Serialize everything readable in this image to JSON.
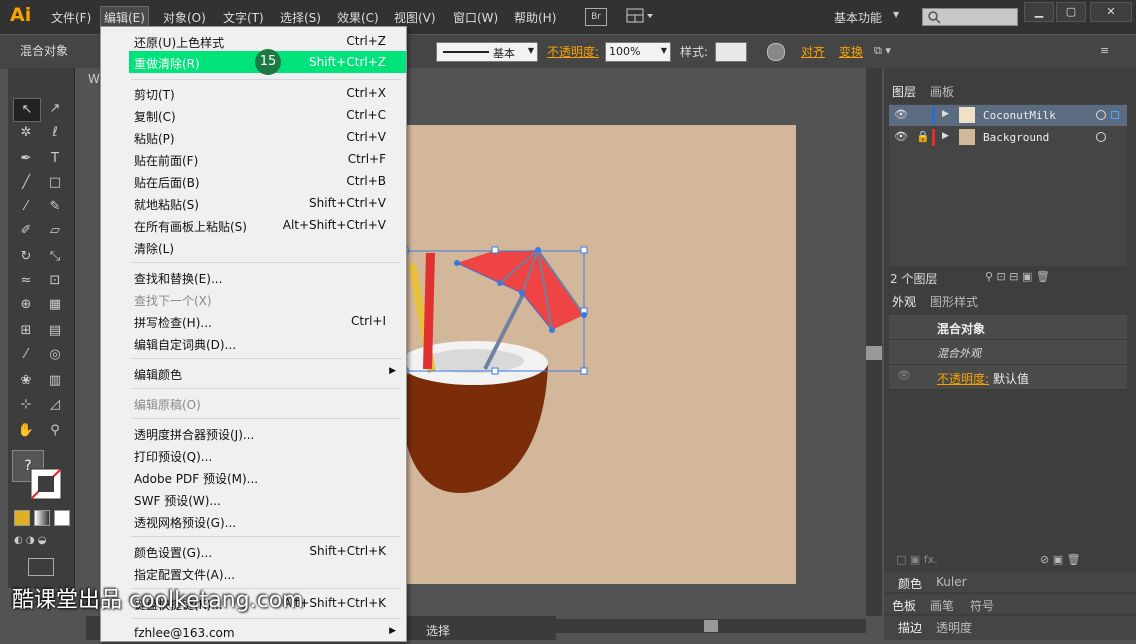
{
  "menubar": {
    "app_logo": "Ai",
    "items": [
      "文件(F)",
      "编辑(E)",
      "对象(O)",
      "文字(T)",
      "选择(S)",
      "效果(C)",
      "视图(V)",
      "窗口(W)",
      "帮助(H)"
    ],
    "br_label": "Br",
    "workspace": "基本功能",
    "window_min": "▁",
    "window_max": "▢",
    "window_close": "✕"
  },
  "control_bar": {
    "object_type": "混合对象",
    "stroke_label": "基本",
    "opacity_label": "不透明度:",
    "opacity_value": "100%",
    "style_label": "样式:",
    "align_label": "对齐",
    "transform_label": "变换"
  },
  "edit_menu": {
    "items": [
      {
        "label": "还原(U)上色样式",
        "shortcut": "Ctrl+Z"
      },
      {
        "label": "重做清除(R)",
        "shortcut": "Shift+Ctrl+Z"
      },
      {
        "label": "剪切(T)",
        "shortcut": "Ctrl+X"
      },
      {
        "label": "复制(C)",
        "shortcut": "Ctrl+C"
      },
      {
        "label": "粘贴(P)",
        "shortcut": "Ctrl+V"
      },
      {
        "label": "贴在前面(F)",
        "shortcut": "Ctrl+F"
      },
      {
        "label": "贴在后面(B)",
        "shortcut": "Ctrl+B"
      },
      {
        "label": "就地粘贴(S)",
        "shortcut": "Shift+Ctrl+V"
      },
      {
        "label": "在所有画板上粘贴(S)",
        "shortcut": "Alt+Shift+Ctrl+V"
      },
      {
        "label": "清除(L)",
        "shortcut": ""
      },
      {
        "label": "查找和替换(E)...",
        "shortcut": ""
      },
      {
        "label": "查找下一个(X)",
        "shortcut": ""
      },
      {
        "label": "拼写检查(H)...",
        "shortcut": "Ctrl+I"
      },
      {
        "label": "编辑自定词典(D)...",
        "shortcut": ""
      },
      {
        "label": "编辑颜色",
        "shortcut": ""
      },
      {
        "label": "编辑原稿(O)",
        "shortcut": ""
      },
      {
        "label": "透明度拼合器预设(J)...",
        "shortcut": ""
      },
      {
        "label": "打印预设(Q)...",
        "shortcut": ""
      },
      {
        "label": "Adobe PDF 预设(M)...",
        "shortcut": ""
      },
      {
        "label": "SWF 预设(W)...",
        "shortcut": ""
      },
      {
        "label": "透视网格预设(G)...",
        "shortcut": ""
      },
      {
        "label": "颜色设置(G)...",
        "shortcut": "Shift+Ctrl+K"
      },
      {
        "label": "指定配置文件(A)...",
        "shortcut": ""
      },
      {
        "label": "键盘快捷键(K)...",
        "shortcut": "Alt+Shift+Ctrl+K"
      },
      {
        "label": "fzhlee@163.com",
        "shortcut": ""
      }
    ],
    "step_badge": "15"
  },
  "layers_panel": {
    "tabs": [
      "图层",
      "画板"
    ],
    "layers": [
      "CoconutMilk",
      "Background"
    ],
    "count": "2 个图层"
  },
  "appearance_panel": {
    "tabs": [
      "外观",
      "图形样式"
    ],
    "title": "混合对象",
    "subtitle": "混合外观",
    "opacity_label": "不透明度:",
    "opacity_value": "默认值"
  },
  "bottom_panels": {
    "color_tabs": [
      "颜色",
      "Kuler"
    ],
    "swatch_tabs": [
      "色板",
      "画笔",
      "符号"
    ],
    "stroke_tabs": [
      "描边",
      "透明度"
    ]
  },
  "status": {
    "tool": "选择",
    "doc_tab": "W"
  },
  "toolbar": {
    "fill_question": "?"
  },
  "watermark": "酷课堂出品 coolketang.com",
  "colors": {
    "highlight": "#00e27a",
    "accent": "#f7a400",
    "artboard": "#d3b79a",
    "umbrella": "#ee4444",
    "coconut_shell": "#7b2d0a"
  }
}
